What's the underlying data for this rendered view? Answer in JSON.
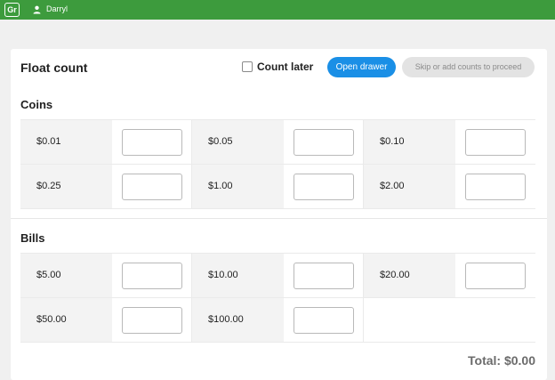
{
  "topbar": {
    "logo_text": "Gr",
    "user_icon": "user-icon",
    "user_name": "Darryl",
    "color": "#3d9b3d"
  },
  "header": {
    "title": "Float count",
    "count_later_label": "Count later",
    "count_later_checked": false,
    "open_drawer_label": "Open drawer",
    "skip_label": "Skip or add counts to proceed",
    "accent": "#1a8fe6"
  },
  "coins": {
    "title": "Coins",
    "rows": [
      [
        {
          "label": "$0.01",
          "value": ""
        },
        {
          "label": "$0.05",
          "value": ""
        },
        {
          "label": "$0.10",
          "value": ""
        }
      ],
      [
        {
          "label": "$0.25",
          "value": ""
        },
        {
          "label": "$1.00",
          "value": ""
        },
        {
          "label": "$2.00",
          "value": ""
        }
      ]
    ]
  },
  "bills": {
    "title": "Bills",
    "rows": [
      [
        {
          "label": "$5.00",
          "value": ""
        },
        {
          "label": "$10.00",
          "value": ""
        },
        {
          "label": "$20.00",
          "value": ""
        }
      ],
      [
        {
          "label": "$50.00",
          "value": ""
        },
        {
          "label": "$100.00",
          "value": ""
        }
      ]
    ]
  },
  "footer": {
    "total": "Total: $0.00"
  }
}
